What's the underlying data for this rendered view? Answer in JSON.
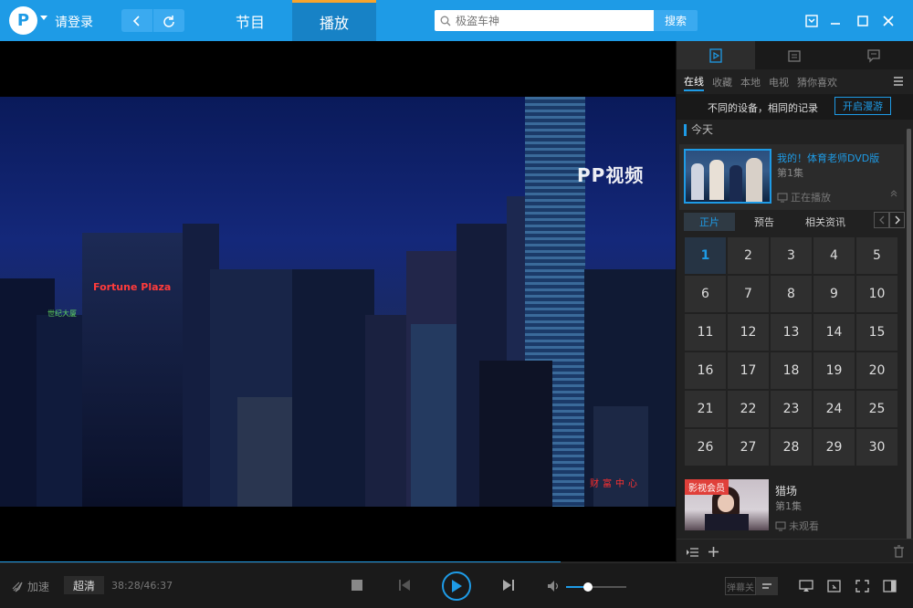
{
  "header": {
    "logo_text": "P",
    "login_label": "请登录",
    "tabs": [
      {
        "label": "节目"
      },
      {
        "label": "播放"
      }
    ],
    "search": {
      "placeholder": "极盗车神",
      "button_label": "搜索"
    }
  },
  "video": {
    "watermark": "PP视频",
    "sign_fortune": "Fortune Plaza",
    "sign_red": "财富中心",
    "sign_green": "世纪大厦",
    "progress": 0.83
  },
  "panel": {
    "subtabs": [
      "在线",
      "收藏",
      "本地",
      "电视",
      "猜你喜欢"
    ],
    "sync_text": "不同的设备，相同的记录",
    "sync_button": "开启漫游",
    "section_title": "今天",
    "current": {
      "title": "我的！体育老师DVD版",
      "episode": "第1集",
      "status": "正在播放"
    },
    "episode_tabs": [
      "正片",
      "预告",
      "相关资讯"
    ],
    "episodes": [
      "1",
      "2",
      "3",
      "4",
      "5",
      "6",
      "7",
      "8",
      "9",
      "10",
      "11",
      "12",
      "13",
      "14",
      "15",
      "16",
      "17",
      "18",
      "19",
      "20",
      "21",
      "22",
      "23",
      "24",
      "25",
      "26",
      "27",
      "28",
      "29",
      "30"
    ],
    "next_item": {
      "badge": "影视会员",
      "title": "猎场",
      "episode": "第1集",
      "status": "未观看"
    }
  },
  "controls": {
    "speed_label": "加速",
    "quality_label": "超清",
    "time": "38:28/46:37",
    "danmu_label": "弹幕关",
    "volume": 0.36
  },
  "colors": {
    "accent": "#1e9be6",
    "tab_active_top": "#f7a42d",
    "vip": "#e0403a"
  }
}
